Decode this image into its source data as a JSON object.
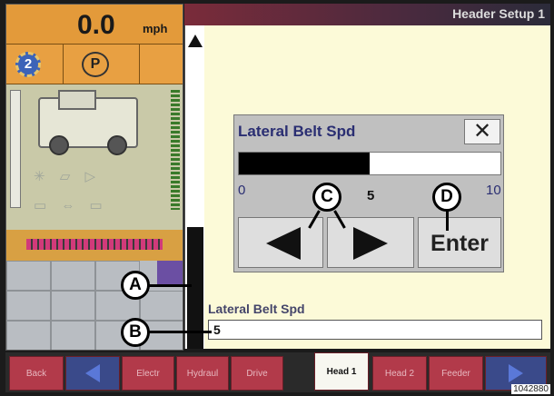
{
  "status": {
    "speed": "0.0",
    "speed_unit": "mph",
    "gear": "2",
    "park": "P"
  },
  "header": {
    "title": "Header Setup 1"
  },
  "dialog": {
    "title": "Lateral Belt Spd",
    "close_glyph": "✕",
    "min": "0",
    "max": "10",
    "current": "5",
    "level": 0.5,
    "enter_label": "Enter"
  },
  "field": {
    "label": "Lateral Belt Spd",
    "value": "5"
  },
  "tabs": [
    {
      "label": "Back"
    },
    {
      "label": ""
    },
    {
      "label": "Electr"
    },
    {
      "label": "Hydraul"
    },
    {
      "label": "Drive"
    },
    {
      "label": "Head 1"
    },
    {
      "label": "Head 2"
    },
    {
      "label": "Feeder"
    },
    {
      "label": ""
    }
  ],
  "callouts": {
    "a": "A",
    "b": "B",
    "c": "C",
    "d": "D"
  },
  "figure_id": "1042880"
}
